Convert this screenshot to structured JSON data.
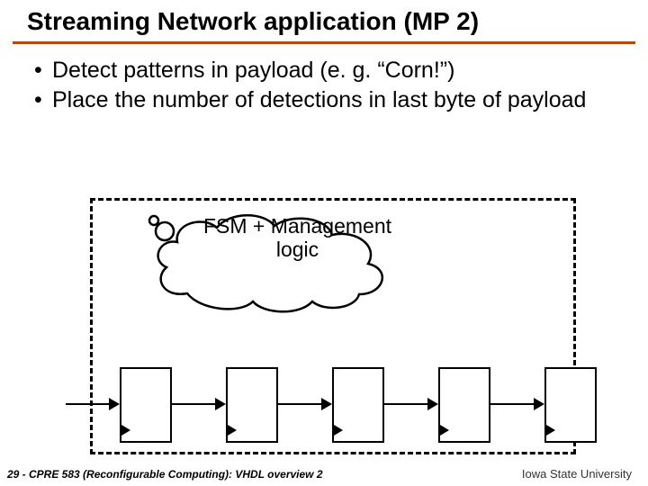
{
  "title": "Streaming Network application (MP 2)",
  "bullets": [
    "Detect patterns in payload (e. g. “Corn!”)",
    "Place the number of detections in last byte of payload"
  ],
  "cloud_label": "FSM + Management logic",
  "footer_left": "29 - CPRE 583 (Reconfigurable Computing): VHDL overview 2",
  "footer_right": "Iowa State University"
}
